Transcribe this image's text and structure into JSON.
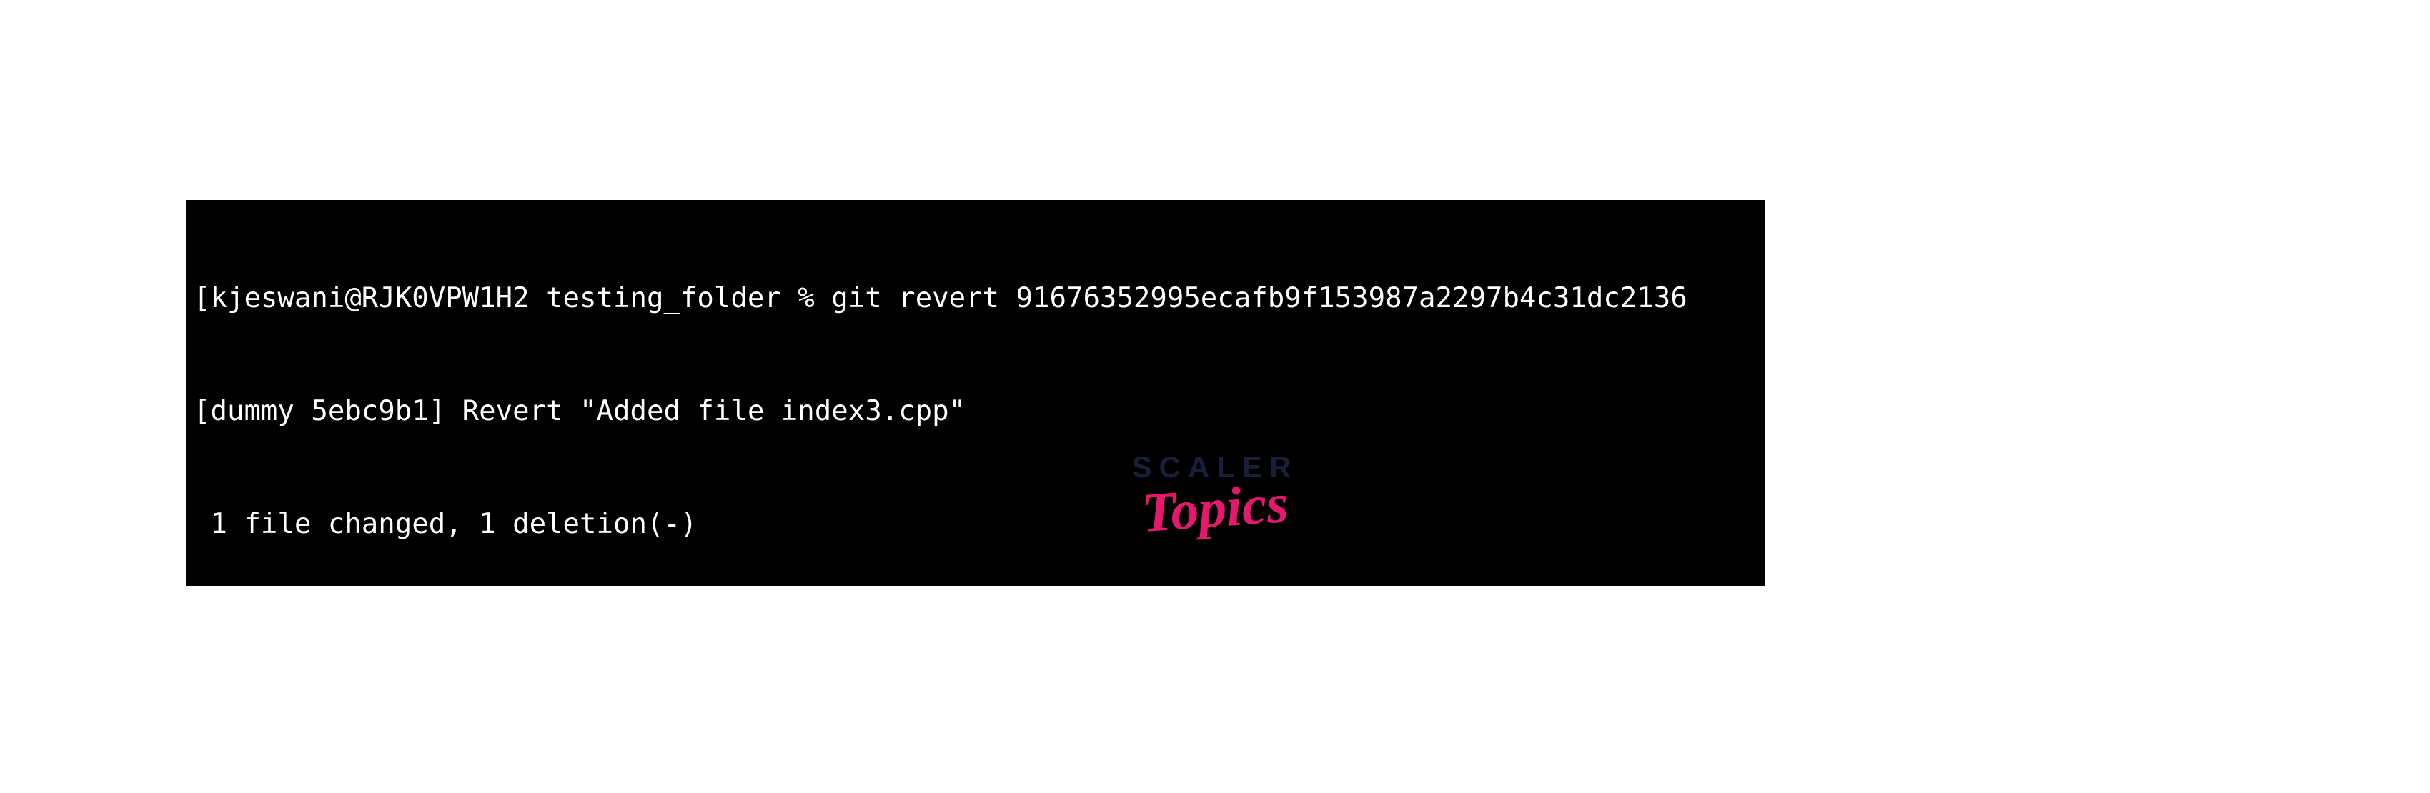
{
  "terminal": {
    "lines": [
      "[kjeswani@RJK0VPW1H2 testing_folder % git revert 91676352995ecafb9f153987a2297b4c31dc2136",
      "[dummy 5ebc9b1] Revert \"Added file index3.cpp\"",
      " 1 file changed, 1 deletion(-)"
    ]
  },
  "watermark": {
    "top": "SCALER",
    "bottom": "Topics"
  }
}
